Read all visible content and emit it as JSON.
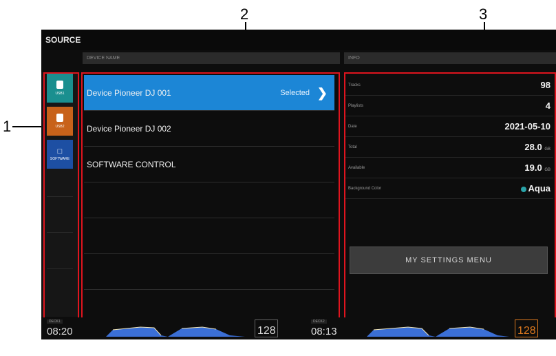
{
  "callouts": {
    "c1": "1",
    "c2": "2",
    "c3": "3"
  },
  "header": {
    "title": "SOURCE"
  },
  "columns": {
    "device_name": "DEVICE NAME",
    "info": "INFO"
  },
  "sources": [
    {
      "label": "USB1",
      "icon": "usb-icon",
      "color": "#1a8f8f"
    },
    {
      "label": "USB2",
      "icon": "usb-icon",
      "color": "#c8621a"
    },
    {
      "label": "SOFTWARE",
      "icon": "laptop-icon",
      "color": "#1d4fa3"
    }
  ],
  "devices": [
    {
      "name": "Device Pioneer DJ 001",
      "status": "Selected",
      "selected": true
    },
    {
      "name": "Device Pioneer DJ 002",
      "status": "",
      "selected": false
    },
    {
      "name": "SOFTWARE CONTROL",
      "status": "",
      "selected": false
    }
  ],
  "info": {
    "rows": [
      {
        "label": "Tracks",
        "value": "98",
        "unit": ""
      },
      {
        "label": "Playlists",
        "value": "4",
        "unit": ""
      },
      {
        "label": "Date",
        "value": "2021-05-10",
        "unit": ""
      },
      {
        "label": "Total",
        "value": "28.0",
        "unit": "GB"
      },
      {
        "label": "Available",
        "value": "19.0",
        "unit": "GB"
      },
      {
        "label": "Background Color",
        "value": "Aqua",
        "unit": "",
        "dot_color": "#2aa3a8"
      }
    ],
    "settings_button": "MY SETTINGS MENU"
  },
  "decks": [
    {
      "label": "DECK1",
      "time": "08:20",
      "bpm": "128",
      "hot": false
    },
    {
      "label": "DECK2",
      "time": "08:13",
      "bpm": "128",
      "hot": true
    }
  ],
  "colors": {
    "selected_row": "#1c86d6",
    "callout_box": "#e0141e"
  }
}
